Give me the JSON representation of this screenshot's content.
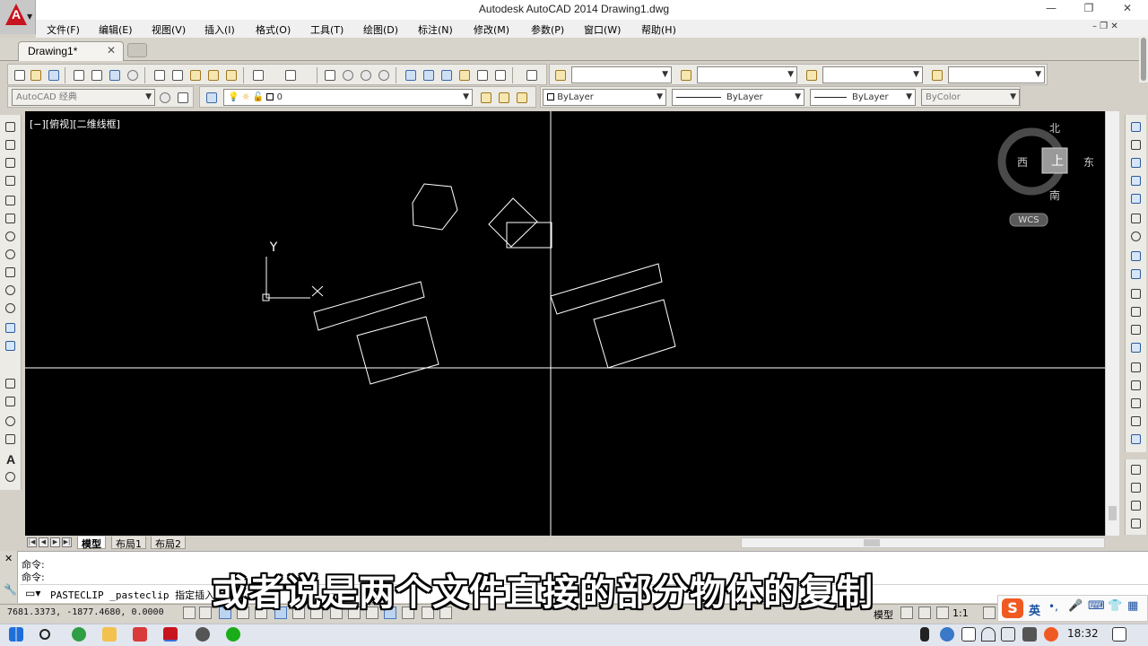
{
  "window": {
    "title": "Autodesk AutoCAD 2014    Drawing1.dwg",
    "minimize": "—",
    "maximize": "❐",
    "close": "✕"
  },
  "menu": {
    "items": [
      "文件(F)",
      "编辑(E)",
      "视图(V)",
      "插入(I)",
      "格式(O)",
      "工具(T)",
      "绘图(D)",
      "标注(N)",
      "修改(M)",
      "参数(P)",
      "窗口(W)",
      "帮助(H)"
    ],
    "doc_controls": "–  ❐  ✕"
  },
  "tabs": {
    "drawing_tab": "Drawing1*",
    "close": "✕"
  },
  "toolbar": {
    "workspace": "AutoCAD 经典",
    "layer": "0",
    "color": "ByLayer",
    "linetype": "ByLayer",
    "lineweight": "ByLayer",
    "plotstyle": "ByColor"
  },
  "viewport": {
    "label": "[−][俯视][二维线框]",
    "ucs_y": "Y",
    "ucs_x": "X",
    "viewcube": {
      "north": "北",
      "south": "南",
      "east": "东",
      "west": "西",
      "top": "上",
      "wcs": "WCS"
    }
  },
  "layout_tabs": [
    "模型",
    "布局1",
    "布局2"
  ],
  "command": {
    "history": [
      "命令:",
      "命令:"
    ],
    "input": "PASTECLIP _pasteclip 指定插入"
  },
  "status": {
    "coordinates": "7681.3373, -1877.4680, 0.0000",
    "model_label": "模型",
    "scale": "1:1"
  },
  "subtitle": "或者说是两个文件直接的部分物体的复制",
  "tray": {
    "ime": "英",
    "time": "18:32"
  },
  "colors": {
    "canvas": "#000000",
    "geometry": "#ffffff",
    "crosshair": "#ffffff",
    "accent_logo": "#c8141e"
  }
}
